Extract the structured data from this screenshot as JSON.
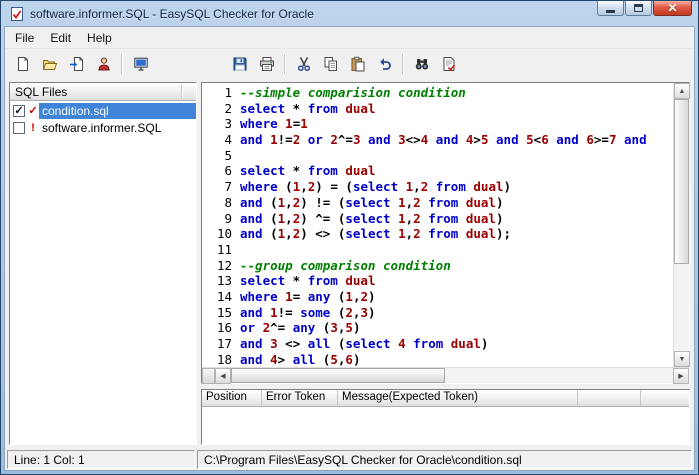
{
  "colors": {
    "selection": "#3f84d6",
    "error_red": "#cc0000",
    "syntax_keyword": "#0000cc",
    "syntax_comment": "#008000",
    "syntax_value": "#990000"
  },
  "window": {
    "title": "software.informer.SQL - EasySQL Checker for Oracle",
    "app_icon": "app-check-icon",
    "controls": [
      {
        "name": "minimize-button",
        "icon": "minimize-icon"
      },
      {
        "name": "maximize-button",
        "icon": "maximize-icon"
      },
      {
        "name": "close-button",
        "icon": "close-icon"
      }
    ]
  },
  "menu": {
    "items": [
      {
        "label": "File"
      },
      {
        "label": "Edit"
      },
      {
        "label": "Help"
      }
    ]
  },
  "toolbar": {
    "groups": [
      {
        "buttons": [
          {
            "name": "new-file",
            "icon": "new-file-icon"
          },
          {
            "name": "open-file",
            "icon": "open-folder-icon"
          },
          {
            "name": "import-file",
            "icon": "import-file-icon"
          },
          {
            "name": "wizard",
            "icon": "wizard-icon"
          }
        ]
      },
      {
        "buttons": [
          {
            "name": "options",
            "icon": "monitor-icon"
          }
        ]
      },
      {
        "offset": true,
        "buttons": [
          {
            "name": "save",
            "icon": "save-icon"
          },
          {
            "name": "print",
            "icon": "print-icon"
          }
        ]
      },
      {
        "buttons": [
          {
            "name": "cut",
            "icon": "cut-icon"
          },
          {
            "name": "copy",
            "icon": "copy-icon"
          },
          {
            "name": "paste",
            "icon": "paste-icon"
          },
          {
            "name": "undo",
            "icon": "undo-icon"
          }
        ]
      },
      {
        "buttons": [
          {
            "name": "find",
            "icon": "find-icon"
          },
          {
            "name": "syntax-check",
            "icon": "syntax-check-icon"
          }
        ]
      }
    ]
  },
  "sidebar": {
    "header": "SQL Files",
    "files": [
      {
        "name": "condition.sql",
        "checked": true,
        "selected": true,
        "status_icon": "red-check-icon",
        "status_glyph": "✓"
      },
      {
        "name": "software.informer.SQL",
        "checked": false,
        "selected": false,
        "status_icon": "red-exclamation-icon",
        "status_glyph": "!"
      }
    ]
  },
  "editor": {
    "keywords": [
      "select",
      "from",
      "where",
      "and",
      "or",
      "any",
      "some",
      "all"
    ],
    "objects": [
      "dual"
    ],
    "lines": [
      "--simple comparision condition",
      "select * from dual",
      "where 1=1",
      "and 1!=2 or 2^=3 and 3<>4 and 4>5 and 5<6 and 6>=7 and",
      "",
      "select * from dual",
      "where (1,2) = (select 1,2 from dual)",
      "and (1,2) != (select 1,2 from dual)",
      "and (1,2) ^= (select 1,2 from dual)",
      "and (1,2) <> (select 1,2 from dual);",
      "",
      "--group comparison condition",
      "select * from dual",
      "where 1= any (1,2)",
      "and 1!= some (2,3)",
      "or 2^= any (3,5)",
      "and 3 <> all (select 4 from dual)",
      "and 4> all (5,6)"
    ]
  },
  "error_panel": {
    "columns": [
      "Position",
      "Error Token",
      "Message(Expected Token)"
    ]
  },
  "statusbar": {
    "position": "Line: 1  Col: 1",
    "path": "C:\\Program Files\\EasySQL Checker for Oracle\\condition.sql"
  }
}
